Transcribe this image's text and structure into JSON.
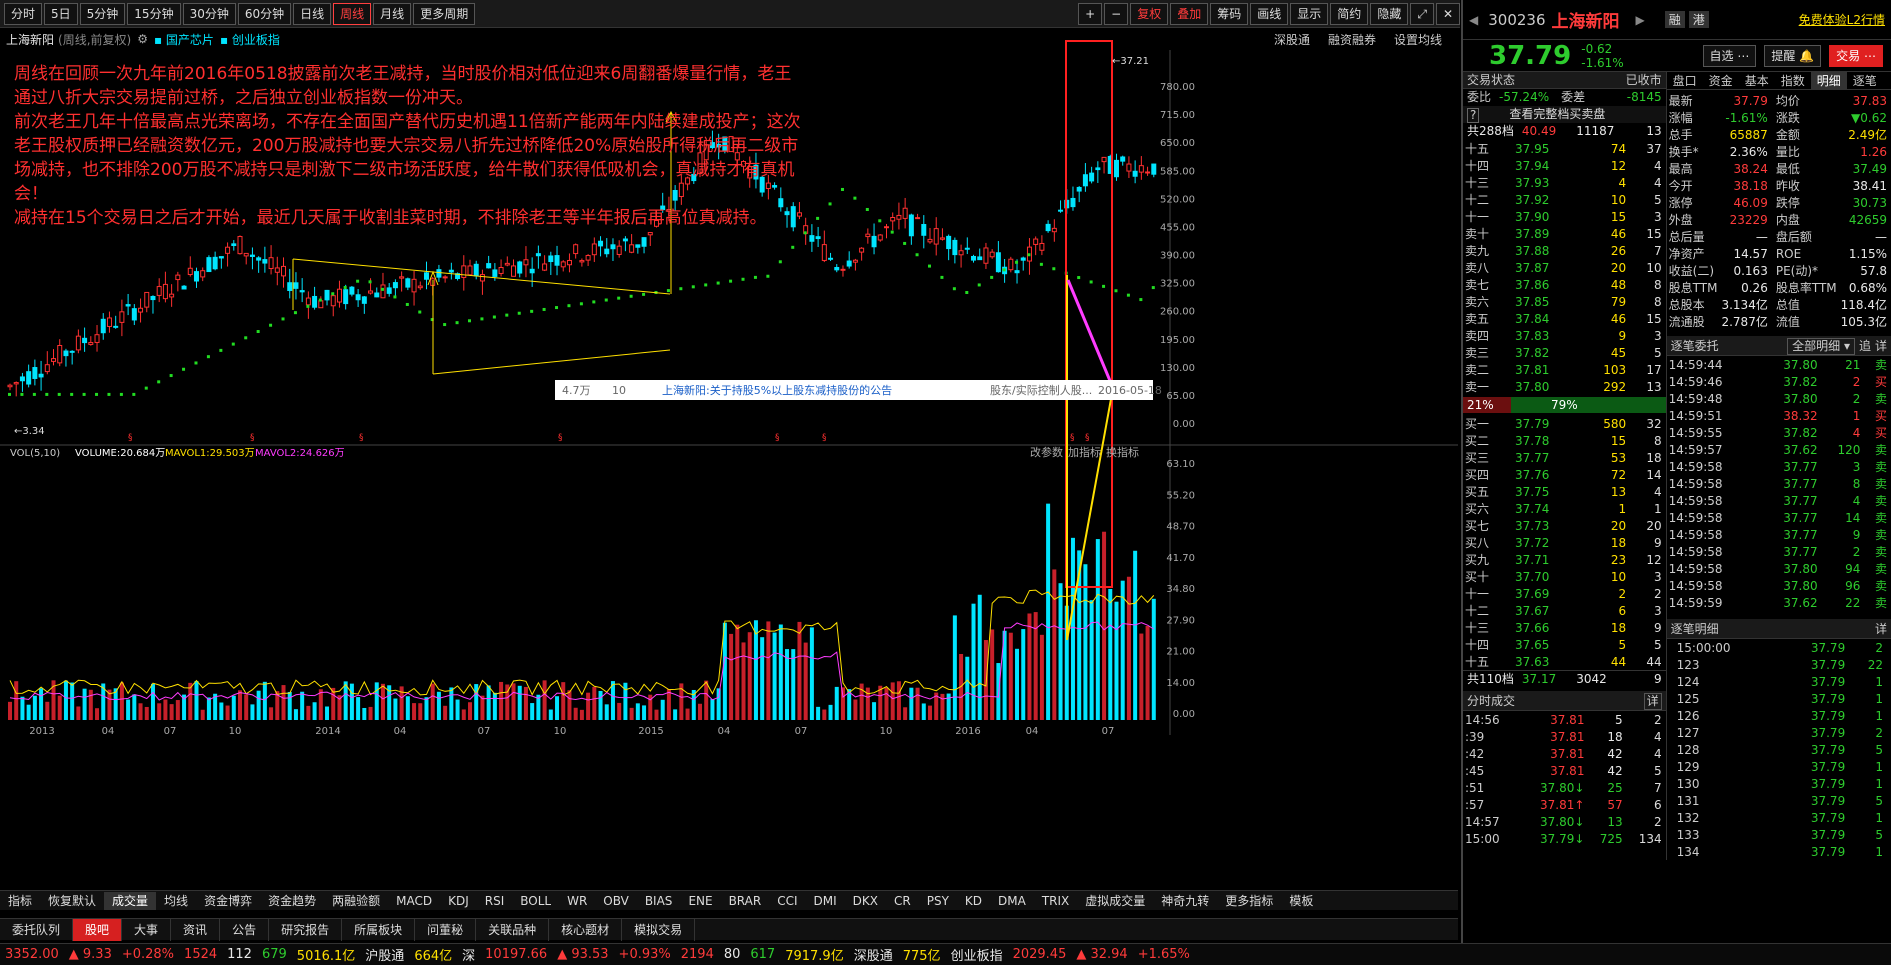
{
  "toolbar": {
    "periods": [
      "分时",
      "5日",
      "5分钟",
      "15分钟",
      "30分钟",
      "60分钟",
      "日线",
      "周线",
      "月线",
      "更多周期"
    ],
    "active_period": "周线",
    "tools": [
      "复权",
      "叠加",
      "筹码",
      "画线",
      "显示",
      "简约",
      "隐藏"
    ]
  },
  "info": {
    "name": "上海新阳",
    "mode": "(周线,前复权)",
    "concept1": "国产芯片",
    "concept2": "创业板指",
    "right1": "深股通",
    "right2": "融资融券",
    "right3": "设置均线"
  },
  "annotation": "周线在回顾一次九年前2016年0518披露前次老王减持，当时股价相对低位迎来6周翻番爆量行情，老王通过八折大宗交易提前过桥，之后独立创业板指数一份冲天。\n前次老王几年十倍最高点光荣离场，不存在全面国产替代历史机遇11倍新产能两年内陆续建成投产；这次老王股权质押已经融资数亿元，200万股减持也要大宗交易八折先过桥降低20%原始股所得税后再二级市场减持，也不排除200万股不减持只是刺激下二级市场活跃度，给牛散们获得低吸机会，真减持才有真机会！\n减持在15个交易日之后才开始，最近几天属于收割韭菜时期，不排除老王等半年报后再高位真减持。",
  "price_axis": [
    "780.00",
    "715.00",
    "650.00",
    "585.00",
    "520.00",
    "455.00",
    "390.00",
    "325.00",
    "260.00",
    "195.00",
    "130.00",
    "65.00",
    "0.00"
  ],
  "vol_axis": [
    "63.10",
    "55.20",
    "48.70",
    "41.70",
    "34.80",
    "27.90",
    "21.00",
    "14.00",
    "0.00"
  ],
  "date_axis": [
    "2013",
    "04",
    "07",
    "10",
    "2014",
    "04",
    "07",
    "10",
    "2015",
    "04",
    "07",
    "10",
    "2016",
    "04",
    "07"
  ],
  "high_mark": "37.21",
  "low_mark": "3.34",
  "notice": {
    "vol": "4.7万",
    "num": "10",
    "title": "上海新阳:关于持股5%以上股东减持股份的公告",
    "type": "股东/实际控制人股...",
    "date": "2016-05-18"
  },
  "vol_legend": {
    "name": "VOL(5,10)",
    "volume": "VOLUME:20.684万",
    "ma1": "MAVOL1:29.503万",
    "ma2": "MAVOL2:24.626万"
  },
  "vol_right": [
    "改参数",
    "加指标",
    "换指标"
  ],
  "indicators": [
    "指标",
    "恢复默认",
    "成交量",
    "均线",
    "资金博弈",
    "资金趋势",
    "两融验额",
    "MACD",
    "KDJ",
    "RSI",
    "BOLL",
    "WR",
    "OBV",
    "BIAS",
    "ENE",
    "BRAR",
    "CCI",
    "DMI",
    "DKX",
    "CR",
    "PSY",
    "KD",
    "DMA",
    "TRIX",
    "虚拟成交量",
    "神奇九转",
    "更多指标",
    "模板"
  ],
  "bottom_tabs": [
    "委托队列",
    "股吧",
    "大事",
    "资讯",
    "公告",
    "研究报告",
    "所属板块",
    "问董秘",
    "关联品种",
    "核心题材",
    "模拟交易"
  ],
  "status": [
    {
      "t": "3352.00",
      "c": "red"
    },
    {
      "t": "▲ 9.33",
      "c": "red"
    },
    {
      "t": "+0.28%",
      "c": "red"
    },
    {
      "t": "1524",
      "c": "red"
    },
    {
      "t": "112",
      "c": "white"
    },
    {
      "t": "679",
      "c": "green"
    },
    {
      "t": "5016.1亿",
      "c": "yellow"
    },
    {
      "t": "沪股通",
      "c": "white"
    },
    {
      "t": "664亿",
      "c": "yellow"
    },
    {
      "t": "深",
      "c": "white"
    },
    {
      "t": "10197.66",
      "c": "red"
    },
    {
      "t": "▲ 93.53",
      "c": "red"
    },
    {
      "t": "+0.93%",
      "c": "red"
    },
    {
      "t": "2194",
      "c": "red"
    },
    {
      "t": "80",
      "c": "white"
    },
    {
      "t": "617",
      "c": "green"
    },
    {
      "t": "7917.9亿",
      "c": "yellow"
    },
    {
      "t": "深股通",
      "c": "white"
    },
    {
      "t": "775亿",
      "c": "yellow"
    },
    {
      "t": "创业板指",
      "c": "white"
    },
    {
      "t": "2029.45",
      "c": "red"
    },
    {
      "t": "▲ 32.94",
      "c": "red"
    },
    {
      "t": "+1.65%",
      "c": "red"
    }
  ],
  "quote": {
    "code": "300236",
    "name": "上海新阳",
    "price": "37.79",
    "change": "-0.62",
    "pct": "-1.61%",
    "free": "免费体验L2行情",
    "btn1": "自选",
    "btn2": "提醒",
    "btn3": "交易",
    "b1": "融",
    "b2": "港"
  },
  "book": {
    "title": "交易状态",
    "state": "已收市",
    "ratio_l": "委比",
    "ratio": "-57.24%",
    "diff_l": "委差",
    "diff": "-8145",
    "view": "查看完整档买卖盘",
    "total_top_l": "共288档",
    "total_top": [
      "40.49",
      "11187",
      "13"
    ],
    "total_bot_l": "共110档",
    "total_bot": [
      "37.17",
      "3042",
      "9"
    ],
    "pct_sell": "21%",
    "pct_buy": "79%",
    "sells": [
      [
        "十五",
        "37.95",
        "74",
        "37"
      ],
      [
        "十四",
        "37.94",
        "12",
        "4"
      ],
      [
        "十三",
        "37.93",
        "4",
        "4"
      ],
      [
        "十二",
        "37.92",
        "10",
        "5"
      ],
      [
        "十一",
        "37.90",
        "15",
        "3"
      ],
      [
        "卖十",
        "37.89",
        "46",
        "15"
      ],
      [
        "卖九",
        "37.88",
        "26",
        "7"
      ],
      [
        "卖八",
        "37.87",
        "20",
        "10"
      ],
      [
        "卖七",
        "37.86",
        "48",
        "8"
      ],
      [
        "卖六",
        "37.85",
        "79",
        "8"
      ],
      [
        "卖五",
        "37.84",
        "46",
        "15"
      ],
      [
        "卖四",
        "37.83",
        "9",
        "3"
      ],
      [
        "卖三",
        "37.82",
        "45",
        "5"
      ],
      [
        "卖二",
        "37.81",
        "103",
        "17"
      ],
      [
        "卖一",
        "37.80",
        "292",
        "13"
      ]
    ],
    "buys": [
      [
        "买一",
        "37.79",
        "580",
        "32"
      ],
      [
        "买二",
        "37.78",
        "15",
        "8"
      ],
      [
        "买三",
        "37.77",
        "53",
        "18"
      ],
      [
        "买四",
        "37.76",
        "72",
        "14"
      ],
      [
        "买五",
        "37.75",
        "13",
        "4"
      ],
      [
        "买六",
        "37.74",
        "1",
        "1"
      ],
      [
        "买七",
        "37.73",
        "20",
        "20"
      ],
      [
        "买八",
        "37.72",
        "18",
        "9"
      ],
      [
        "买九",
        "37.71",
        "23",
        "12"
      ],
      [
        "买十",
        "37.70",
        "10",
        "3"
      ],
      [
        "十一",
        "37.69",
        "2",
        "2"
      ],
      [
        "十二",
        "37.67",
        "6",
        "3"
      ],
      [
        "十三",
        "37.66",
        "18",
        "9"
      ],
      [
        "十四",
        "37.65",
        "5",
        "5"
      ],
      [
        "十五",
        "37.63",
        "44",
        "44"
      ]
    ]
  },
  "tabs": [
    "盘口",
    "资金",
    "基本",
    "指数",
    "明细",
    "逐笔"
  ],
  "stats": [
    [
      "最新",
      "37.79",
      "red",
      "均价",
      "37.83",
      "red"
    ],
    [
      "涨幅",
      "-1.61%",
      "green",
      "涨跌",
      "▼0.62",
      "green"
    ],
    [
      "总手",
      "65887",
      "yellow",
      "金额",
      "2.49亿",
      "yellow"
    ],
    [
      "换手*",
      "2.36%",
      "white",
      "量比",
      "1.26",
      "red"
    ],
    [
      "最高",
      "38.24",
      "red",
      "最低",
      "37.49",
      "green"
    ],
    [
      "今开",
      "38.18",
      "red",
      "昨收",
      "38.41",
      "white"
    ],
    [
      "涨停",
      "46.09",
      "red",
      "跌停",
      "30.73",
      "green"
    ],
    [
      "外盘",
      "23229",
      "red",
      "内盘",
      "42659",
      "green"
    ],
    [
      "总后量",
      "—",
      "white",
      "盘后额",
      "—",
      "white"
    ],
    [
      "净资产",
      "14.57",
      "white",
      "ROE",
      "1.15%",
      "white"
    ],
    [
      "收益(二)",
      "0.163",
      "white",
      "PE(动)*",
      "57.8",
      "white"
    ],
    [
      "股息TTM",
      "0.26",
      "white",
      "股息率TTM",
      "0.68%",
      "white"
    ],
    [
      "总股本",
      "3.134亿",
      "white",
      "总值",
      "118.4亿",
      "white"
    ],
    [
      "流通股",
      "2.787亿",
      "white",
      "流值",
      "105.3亿",
      "white"
    ]
  ],
  "entrust": {
    "title": "逐笔委托",
    "filter": "全部明细",
    "b1": "追",
    "b2": "详",
    "rows": [
      [
        "14:59:44",
        "37.80",
        "21",
        "卖"
      ],
      [
        "14:59:46",
        "37.82",
        "2",
        "买"
      ],
      [
        "14:59:48",
        "37.80",
        "2",
        "卖"
      ],
      [
        "14:59:51",
        "38.32",
        "1",
        "买"
      ],
      [
        "14:59:55",
        "37.82",
        "4",
        "买"
      ],
      [
        "14:59:57",
        "37.62",
        "120",
        "卖"
      ],
      [
        "14:59:58",
        "37.77",
        "3",
        "卖"
      ],
      [
        "14:59:58",
        "37.77",
        "8",
        "卖"
      ],
      [
        "14:59:58",
        "37.77",
        "4",
        "卖"
      ],
      [
        "14:59:58",
        "37.77",
        "14",
        "卖"
      ],
      [
        "14:59:58",
        "37.77",
        "9",
        "卖"
      ],
      [
        "14:59:58",
        "37.77",
        "2",
        "卖"
      ],
      [
        "14:59:58",
        "37.80",
        "94",
        "卖"
      ],
      [
        "14:59:58",
        "37.80",
        "96",
        "卖"
      ],
      [
        "14:59:59",
        "37.62",
        "22",
        "卖"
      ]
    ]
  },
  "detail": {
    "title": "逐笔明细",
    "b": "详",
    "rows": [
      [
        "15:00:00",
        "37.79",
        "2"
      ],
      [
        "123",
        "37.79",
        "22"
      ],
      [
        "124",
        "37.79",
        "1"
      ],
      [
        "125",
        "37.79",
        "1"
      ],
      [
        "126",
        "37.79",
        "1"
      ],
      [
        "127",
        "37.79",
        "2"
      ],
      [
        "128",
        "37.79",
        "5"
      ],
      [
        "129",
        "37.79",
        "1"
      ],
      [
        "130",
        "37.79",
        "1"
      ],
      [
        "131",
        "37.79",
        "5"
      ],
      [
        "132",
        "37.79",
        "1"
      ],
      [
        "133",
        "37.79",
        "5"
      ],
      [
        "134",
        "37.79",
        "1"
      ]
    ]
  },
  "ticks": {
    "title": "分时成交",
    "b": "详",
    "rows": [
      [
        "14:56",
        "37.81",
        "5",
        "2",
        "r",
        "",
        ""
      ],
      [
        ":39",
        "37.81",
        "18",
        "4",
        "r",
        "",
        ""
      ],
      [
        ":42",
        "37.81",
        "42",
        "4",
        "r",
        "",
        ""
      ],
      [
        ":45",
        "37.81",
        "42",
        "5",
        "r",
        "",
        ""
      ],
      [
        ":51",
        "37.80",
        "25",
        "7",
        "g",
        "↓",
        "g"
      ],
      [
        ":57",
        "37.81",
        "57",
        "6",
        "r",
        "↑",
        "r"
      ],
      [
        "14:57",
        "37.80",
        "13",
        "2",
        "g",
        "↓",
        "g"
      ],
      [
        "15:00",
        "37.79",
        "725",
        "134",
        "g",
        "↓",
        "g"
      ]
    ]
  }
}
